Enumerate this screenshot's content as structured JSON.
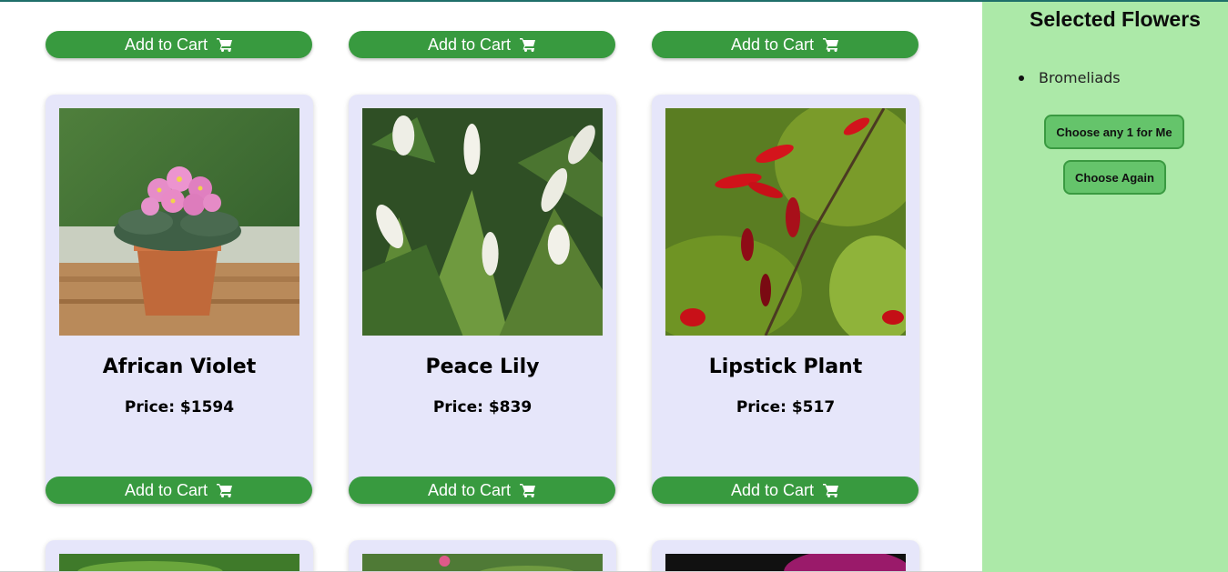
{
  "sidebar": {
    "title": "Selected Flowers",
    "selected": [
      "Bromeliads"
    ],
    "choose_one_label": "Choose any 1 for Me",
    "choose_again_label": "Choose Again"
  },
  "cart_label": "Add to Cart",
  "cards": [
    {
      "name": "African Violet",
      "price": "Price: $1594"
    },
    {
      "name": "Peace Lily",
      "price": "Price: $839"
    },
    {
      "name": "Lipstick Plant",
      "price": "Price: $517"
    }
  ],
  "colors": {
    "sidebar_bg": "#ace9a8",
    "card_bg": "#e6e6fa",
    "cart_button": "#389a3f",
    "side_button": "#65c46b"
  },
  "icons": {
    "cart": "shopping-cart-icon"
  }
}
